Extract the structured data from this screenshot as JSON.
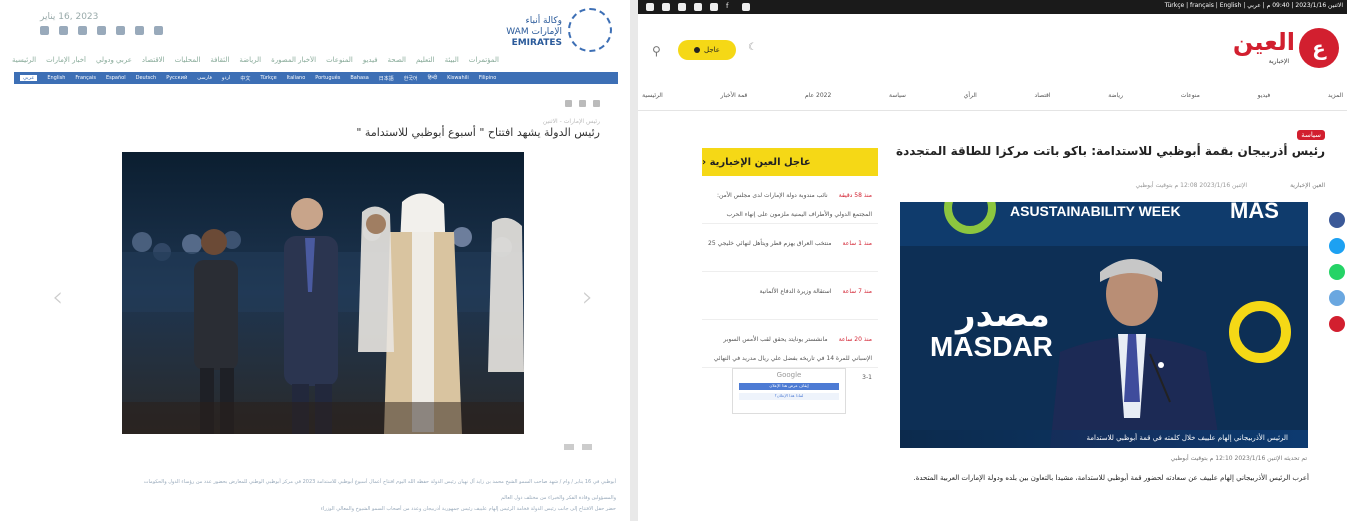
{
  "wam": {
    "date": "2023 ,16 يناير",
    "logo_text": "وكالة أنباء الإمارات WAM",
    "logo_brand": "EMIRATES",
    "nav": [
      "الرئيسية",
      "أخبار الإمارات",
      "عربي ودولي",
      "الاقتصاد",
      "المحليات",
      "الثقافة",
      "الرياضة",
      "الأخبار المصورة",
      "المنوعات",
      "فيديو",
      "الصحة",
      "التعليم",
      "البيئة",
      "المؤتمرات"
    ],
    "lang_bar": [
      "عربي",
      "English",
      "Français",
      "Español",
      "Deutsch",
      "Русский",
      "فارسی",
      "اردو",
      "中文",
      "Türkçe",
      "Italiano",
      "Português",
      "Bahasa",
      "日本語",
      "한국어",
      "हिन्दी",
      "Kiswahili",
      "Filipino"
    ],
    "meta": "رئيس الإمارات - الاثنين",
    "title": "رئيس الدولة يشهد افتتاح \" أسبوع أبوظبي للاستدامة \"",
    "body_lines": [
      "أبوظبي في 16 يناير / وام / شهد صاحب السمو الشيخ محمد بن زايد آل نهيان رئيس الدولة حفظه الله اليوم افتتاح أعمال أسبوع أبوظبي للاستدامة 2023 في مركز أبوظبي الوطني للمعارض بحضور عدد من رؤساء الدول والحكومات",
      "والمسؤولين وقادة الفكر والخبراء من مختلف دول العالم",
      "حضر حفل الافتتاح إلى جانب رئيس الدولة فخامة الرئيس إلهام علييف رئيس جمهورية أذربيجان وعدد من أصحاب السمو الشيوخ والمعالي الوزراء"
    ]
  },
  "alain": {
    "top_meta": "الاثنين 2023/1/16 | 09:40 م | عربي | Türkçe | français | English",
    "breaking_label": "عاجل",
    "logo_word": "العين",
    "logo_sub": "الإخبارية",
    "logo_mark": "ع",
    "nav": [
      "الرئيسية",
      "قمة الأخبار",
      "2022 عام",
      "سياسة",
      "الرأي",
      "اقتصاد",
      "رياضة",
      "منوعات",
      "فيديو",
      "المزيد"
    ],
    "tag": "سياسة",
    "headline": "رئيس أذربيجان بقمة أبوظبي للاستدامة: باكو باتت مركزا للطاقة المتجددة",
    "source": "العين الإخبارية",
    "date1": "الإثنين 2023/1/16 12:08 م بتوقيت أبوظبي",
    "photo_banner_left": "ASUSTAINABILITY WEEK",
    "photo_masdar_ar": "مصدر",
    "photo_masdar_en": "MASDAR",
    "photo_mas": "MAS",
    "photo_caption": "الرئيس الأذربيجاني إلهام علييف خلال كلمته في قمة أبوظبي للاستدامة",
    "date2": "تم تحديثه الإثنين 2023/1/16 12:10 م بتوقيت أبوظبي",
    "lead": "أعرب الرئيس الأذربيجاني إلهام علييف عن سعادته لحضور قمة أبوظبي للاستدامة، مشيدا بالتعاون بين بلده ودولة الإمارات العربية المتحدة.",
    "sidebar_title": "عاجل العين الإخبارية",
    "sidebar_items": [
      {
        "time": "منذ 58 دقيقة",
        "text": "نائب مندوبة دولة الإمارات لدى مجلس الأمن: المجتمع الدولي والأطراف اليمنية ملزمون على إنهاء الحرب"
      },
      {
        "time": "منذ 1 ساعة",
        "text": "منتخب العراق يهزم قطر ويتأهل لنهائي خليجي 25"
      },
      {
        "time": "منذ 7 ساعة",
        "text": "استقالة وزيرة الدفاع الألمانية"
      },
      {
        "time": "منذ 20 ساعة",
        "text": "مانشستر يونايتد يحقق لقب الأمس السوبر الإسباني للمرة 14 في تاريخه بفضل علي ريال مدريد في النهائي 1-3"
      }
    ],
    "ad_brand": "Google",
    "ad_btn": "إيقاف عرض هذا الإعلان",
    "ad_btn2": "لماذا هذا الإعلان؟"
  },
  "colors": {
    "wam_blue": "#3d6fb5",
    "alain_red": "#d21f2f",
    "alain_yellow": "#f5d816"
  },
  "icons": {
    "share": [
      "facebook-icon",
      "twitter-icon",
      "whatsapp-icon",
      "telegram-icon",
      "pinterest-icon"
    ]
  }
}
